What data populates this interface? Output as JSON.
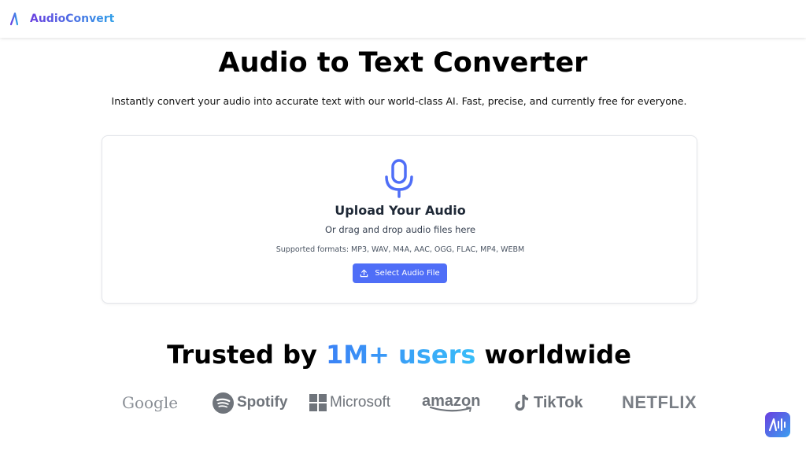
{
  "header": {
    "logo_text": "AudioConvert",
    "logo_icon": "audio-waveform-icon"
  },
  "hero": {
    "title": "Audio to Text Converter",
    "subtitle": "Instantly convert your audio into accurate text with our world-class AI. Fast, precise, and currently free for everyone."
  },
  "upload": {
    "icon": "microphone-icon",
    "title": "Upload Your Audio",
    "hint": "Or drag and drop audio files here",
    "formats": "Supported formats: MP3, WAV, M4A, AAC, OGG, FLAC, MP4, WEBM",
    "button_label": "Select Audio File",
    "button_icon": "upload-icon"
  },
  "trusted": {
    "prefix": "Trusted by",
    "highlight": "1M+ users",
    "suffix": "worldwide"
  },
  "brands": [
    "Google",
    "Spotify",
    "Microsoft",
    "amazon",
    "TikTok",
    "NETFLIX"
  ],
  "colors": {
    "accent": "#4f6ef7",
    "brand_gradient_start": "#6a3fe0",
    "brand_gradient_end": "#2f9fe8",
    "highlight_start": "#3b82f6",
    "highlight_end": "#38bdf8"
  },
  "floating_button": {
    "icon": "audio-waveform-icon"
  }
}
